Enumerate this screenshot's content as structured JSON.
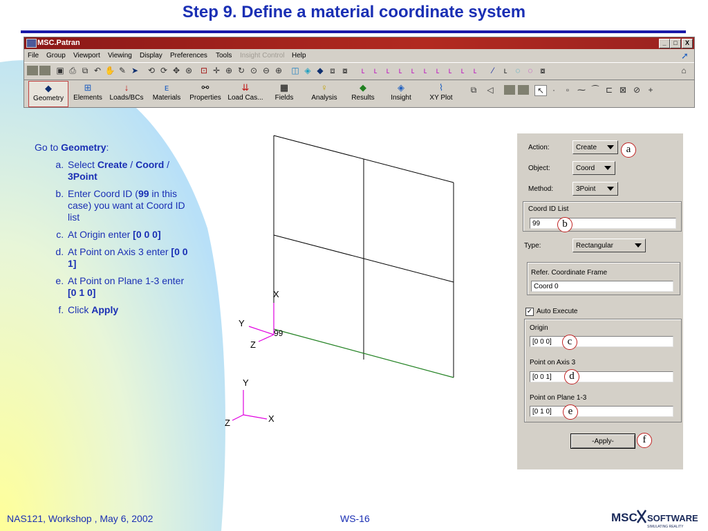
{
  "slide": {
    "title": "Step 9. Define a material coordinate system"
  },
  "window": {
    "title": "MSC.Patran",
    "controls": [
      "_",
      "□",
      "X"
    ],
    "menus": [
      "File",
      "Group",
      "Viewport",
      "Viewing",
      "Display",
      "Preferences",
      "Tools",
      "Insight Control",
      "Help"
    ],
    "apps": [
      "Geometry",
      "Elements",
      "Loads/BCs",
      "Materials",
      "Properties",
      "Load Cas...",
      "Fields",
      "Analysis",
      "Results",
      "Insight",
      "XY Plot"
    ]
  },
  "instructions": {
    "intro_prefix": "Go to ",
    "intro_bold": "Geometry",
    "intro_suffix": ":",
    "a": {
      "t1": "Select ",
      "b1": "Create",
      "t2": " / ",
      "b2": "Coord",
      "t3": " / ",
      "b3": "3Point"
    },
    "b": {
      "t1": "Enter Coord ID (",
      "b1": "99",
      "t2": " in this case) you want at Coord ID list"
    },
    "c": {
      "t1": "At Origin enter ",
      "b1": "[0 0 0]"
    },
    "d": {
      "t1": "At Point on Axis 3 enter ",
      "b1": "[0 0 1]"
    },
    "e": {
      "t1": "At Point on Plane 1-3 enter ",
      "b1": "[0 1 0]"
    },
    "f": {
      "t1": "Click ",
      "b1": "Apply"
    }
  },
  "viewport": {
    "coord_label": "99",
    "triad1": {
      "x": "X",
      "y": "Y",
      "z": "Z"
    },
    "triad2": {
      "x": "X",
      "y": "Y",
      "z": "Z"
    }
  },
  "form": {
    "action_label": "Action:",
    "action_value": "Create",
    "object_label": "Object:",
    "object_value": "Coord",
    "method_label": "Method:",
    "method_value": "3Point",
    "coord_id_label": "Coord ID List",
    "coord_id_value": "99",
    "type_label": "Type:",
    "type_value": "Rectangular",
    "ref_frame_label": "Refer. Coordinate Frame",
    "ref_frame_value": "Coord 0",
    "auto_execute_label": "Auto Execute",
    "auto_execute_checked": true,
    "origin_label": "Origin",
    "origin_value": "[0 0 0]",
    "axis3_label": "Point on Axis 3",
    "axis3_value": "[0 0 1]",
    "plane13_label": "Point on Plane 1-3",
    "plane13_value": "[0 1 0]",
    "apply_label": "-Apply-"
  },
  "callouts": [
    "a",
    "b",
    "c",
    "d",
    "e",
    "f"
  ],
  "footer": {
    "left": "NAS121, Workshop , May 6, 2002",
    "center": "WS-16",
    "logo_text_1": "MSC",
    "logo_text_2": "SOFTWARE",
    "logo_tagline": "SIMULATING REALITY"
  },
  "colors": {
    "title_blue": "#1a2fb4",
    "titlebar_red": "#a02020",
    "panel_gray": "#d4d0c8",
    "triad_magenta": "#e000e0",
    "edge_green": "#208020"
  }
}
